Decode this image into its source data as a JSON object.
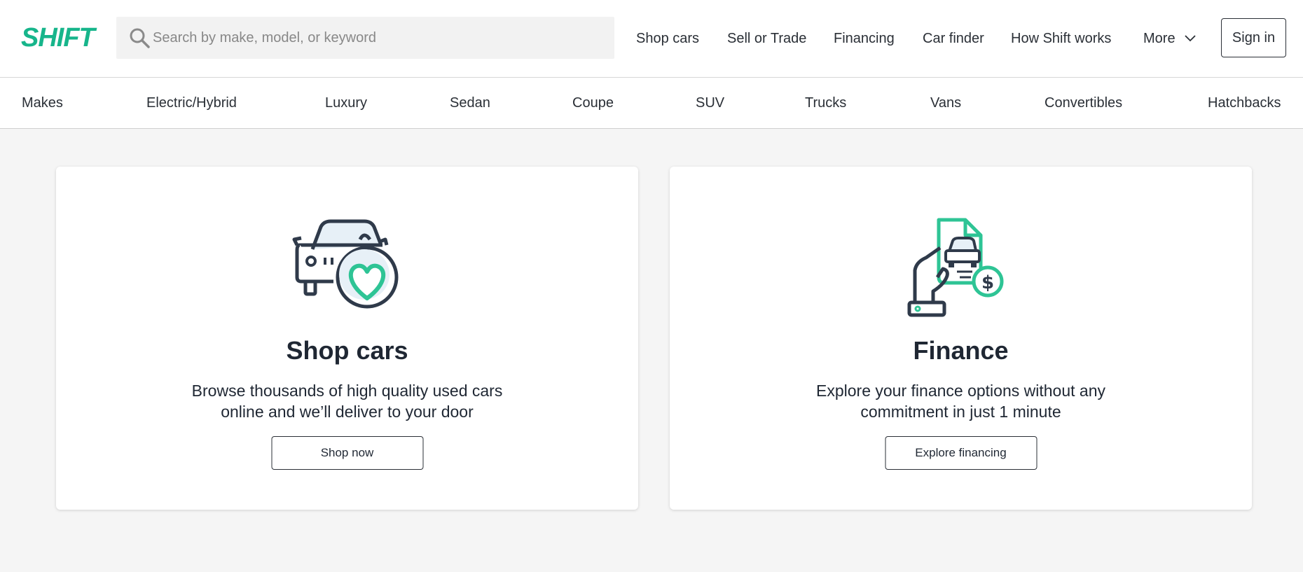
{
  "header": {
    "logo": "SHIFT",
    "search_placeholder": "Search by make, model, or keyword",
    "nav": [
      "Shop cars",
      "Sell or Trade",
      "Financing",
      "Car finder",
      "How Shift works",
      "More"
    ],
    "sign_in": "Sign in"
  },
  "categories": [
    "Makes",
    "Electric/Hybrid",
    "Luxury",
    "Sedan",
    "Coupe",
    "SUV",
    "Trucks",
    "Vans",
    "Convertibles",
    "Hatchbacks"
  ],
  "cards": {
    "shop": {
      "title": "Shop cars",
      "text": "Browse thousands of high quality used cars online and we’ll deliver to your door",
      "button": "Shop now"
    },
    "finance": {
      "title": "Finance",
      "text": "Explore your finance options without any commitment in just 1 minute",
      "button": "Explore financing"
    }
  },
  "colors": {
    "brand": "#17b58b",
    "text": "#1f2733",
    "background": "#f5f5f5"
  }
}
